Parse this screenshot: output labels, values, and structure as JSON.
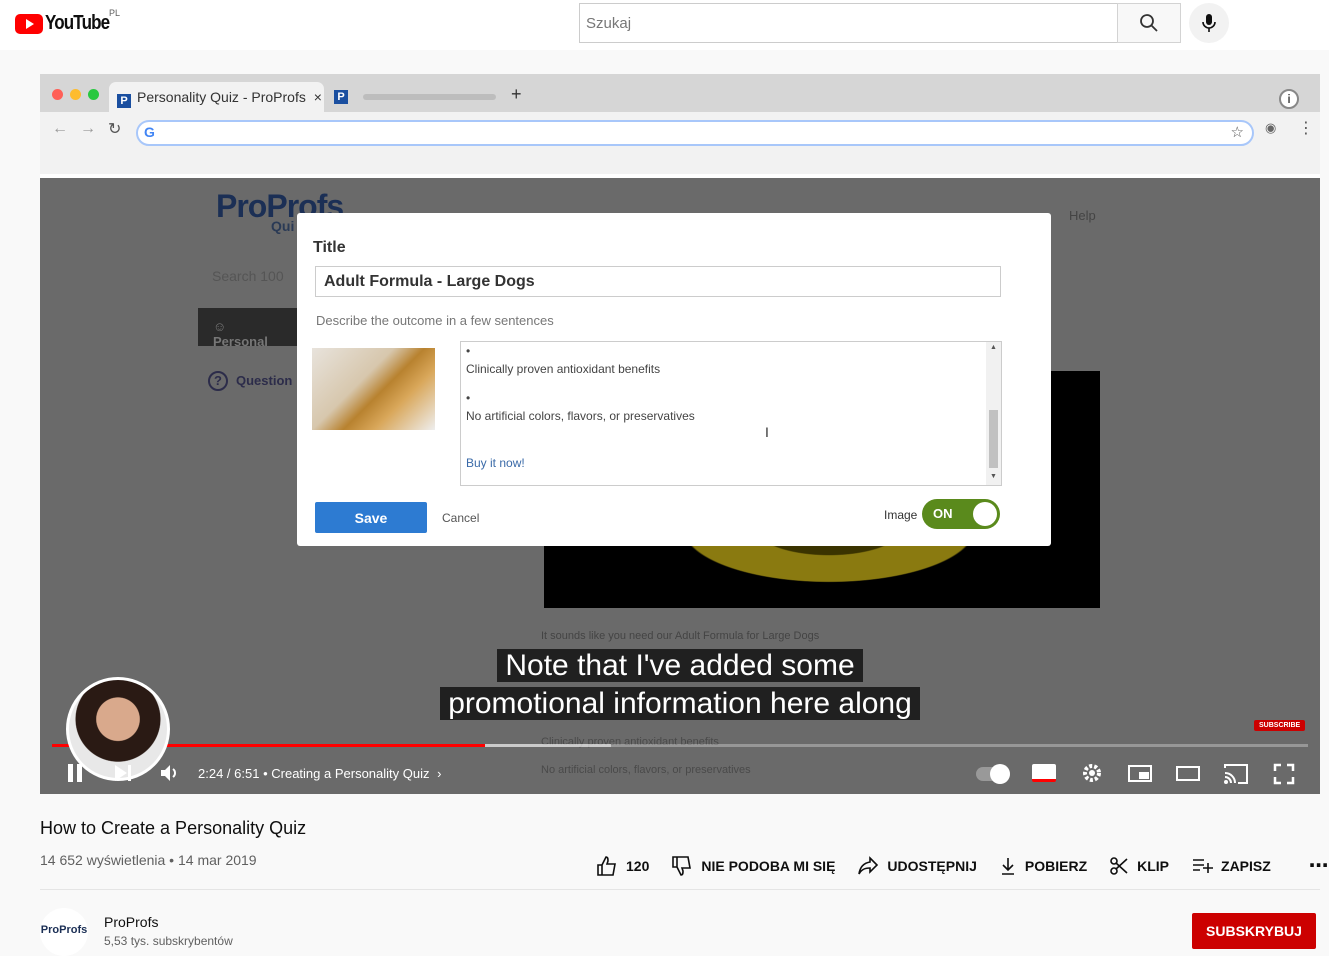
{
  "youtube": {
    "logo_text": "YouTube",
    "country": "PL",
    "search_placeholder": "Szukaj"
  },
  "browser": {
    "tab_title": "Personality Quiz - ProProfs",
    "tab_close": "×",
    "new_tab": "+"
  },
  "quiz_page": {
    "logo": "ProProfs",
    "logo_sub": "Qui",
    "help": "Help",
    "search_placeholder": "Search 100",
    "sidebar_personality": "Personal",
    "sidebar_questions": "Question",
    "below_text_1": "It sounds like you need our Adult Formula for Large Dogs",
    "below_text_2": "Clinically proven antioxidant benefits",
    "below_text_3": "No artificial colors, flavors, or preservatives"
  },
  "modal": {
    "title_label": "Title",
    "title_value": "Adult Formula - Large Dogs",
    "desc_label": "Describe the outcome in a few sentences",
    "editor_lines": [
      "•",
      "Clinically proven antioxidant benefits",
      "•",
      "No artificial colors, flavors, or preservatives",
      "Buy it now!"
    ],
    "save": "Save",
    "cancel": "Cancel",
    "image_label": "Image",
    "toggle_state": "ON"
  },
  "captions": [
    "Note that I've added some",
    "promotional information here along"
  ],
  "player": {
    "time": "2:24 / 6:51",
    "chapter": "Creating a Personality Quiz",
    "subscribe_badge": "SUBSCRIBE",
    "progress": 0.345
  },
  "video": {
    "title": "How to Create a Personality Quiz",
    "views": "14 652 wyświetlenia • 14 mar 2019",
    "likes": "120",
    "dislike": "NIE PODOBA MI SIĘ",
    "share": "UDOSTĘPNIJ",
    "download": "POBIERZ",
    "clip": "KLIP",
    "save": "ZAPISZ"
  },
  "channel": {
    "avatar_text": "ProProfs",
    "name": "ProProfs",
    "subs": "5,53 tys. subskrybentów",
    "subscribe": "SUBSKRYBUJ"
  },
  "colors": {
    "yt_red": "#ff0000",
    "subscribe": "#cc0000",
    "save_blue": "#2d7bd2",
    "toggle_green": "#5a8a1c"
  }
}
